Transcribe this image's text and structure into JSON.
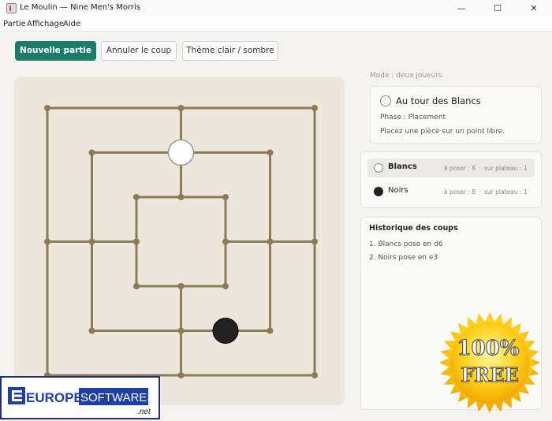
{
  "window": {
    "title": "Le Moulin — Nine Men's Morris",
    "controls": {
      "minimize": "—",
      "maximize": "☐",
      "close": "✕"
    }
  },
  "menu": [
    "Partie",
    "Affichage",
    "Aide"
  ],
  "toolbar": {
    "new_game": "Nouvelle partie",
    "undo": "Annuler le coup",
    "theme": "Thème clair / sombre"
  },
  "board": {
    "board_size": 7,
    "points": [
      [
        0,
        0
      ],
      [
        3,
        0
      ],
      [
        6,
        0
      ],
      [
        1,
        1
      ],
      [
        3,
        1
      ],
      [
        5,
        1
      ],
      [
        2,
        2
      ],
      [
        3,
        2
      ],
      [
        4,
        2
      ],
      [
        0,
        3
      ],
      [
        1,
        3
      ],
      [
        2,
        3
      ],
      [
        4,
        3
      ],
      [
        5,
        3
      ],
      [
        6,
        3
      ],
      [
        2,
        4
      ],
      [
        3,
        4
      ],
      [
        4,
        4
      ],
      [
        1,
        5
      ],
      [
        3,
        5
      ],
      [
        5,
        5
      ],
      [
        0,
        6
      ],
      [
        3,
        6
      ],
      [
        6,
        6
      ]
    ],
    "lines": [
      [
        [
          0,
          0
        ],
        [
          6,
          0
        ]
      ],
      [
        [
          1,
          1
        ],
        [
          5,
          1
        ]
      ],
      [
        [
          2,
          2
        ],
        [
          4,
          2
        ]
      ],
      [
        [
          0,
          3
        ],
        [
          2,
          3
        ]
      ],
      [
        [
          4,
          3
        ],
        [
          6,
          3
        ]
      ],
      [
        [
          2,
          4
        ],
        [
          4,
          4
        ]
      ],
      [
        [
          1,
          5
        ],
        [
          5,
          5
        ]
      ],
      [
        [
          0,
          6
        ],
        [
          6,
          6
        ]
      ],
      [
        [
          0,
          0
        ],
        [
          0,
          6
        ]
      ],
      [
        [
          1,
          1
        ],
        [
          1,
          5
        ]
      ],
      [
        [
          2,
          2
        ],
        [
          2,
          4
        ]
      ],
      [
        [
          3,
          0
        ],
        [
          3,
          2
        ]
      ],
      [
        [
          3,
          4
        ],
        [
          3,
          6
        ]
      ],
      [
        [
          4,
          2
        ],
        [
          4,
          4
        ]
      ],
      [
        [
          5,
          1
        ],
        [
          5,
          5
        ]
      ],
      [
        [
          6,
          0
        ],
        [
          6,
          6
        ]
      ]
    ],
    "pieces": [
      {
        "point": [
          3,
          1
        ],
        "color": "white",
        "square": "d6"
      },
      {
        "point": [
          4,
          5
        ],
        "color": "black",
        "square": "e3"
      }
    ]
  },
  "status": {
    "mode": "Mode : deux joueurs",
    "turn": "Au tour des Blancs",
    "phase": "Phase : Placement",
    "hint": "Placez une pièce sur un point libre."
  },
  "players": [
    {
      "name": "Blancs",
      "to_place": "à poser : 8",
      "on_board": "sur plateau : 1",
      "active": true
    },
    {
      "name": "Noirs",
      "to_place": "à poser : 8",
      "on_board": "sur plateau : 1",
      "active": false
    }
  ],
  "history": {
    "title": "Historique des coups",
    "moves": [
      "1. Blancs pose en d6",
      "2. Noirs pose en e3"
    ]
  },
  "watermark": {
    "europe": "EUROPE",
    "softwares": "SOFTWARES",
    "net": ".net",
    "badge_top": "100%",
    "badge_bottom": "FREE"
  },
  "colors": {
    "accent": "#1d7c68",
    "board": "#ede7db",
    "lines": "#8f7a57",
    "black_piece": "#222222",
    "white_piece": "#ffffff"
  }
}
